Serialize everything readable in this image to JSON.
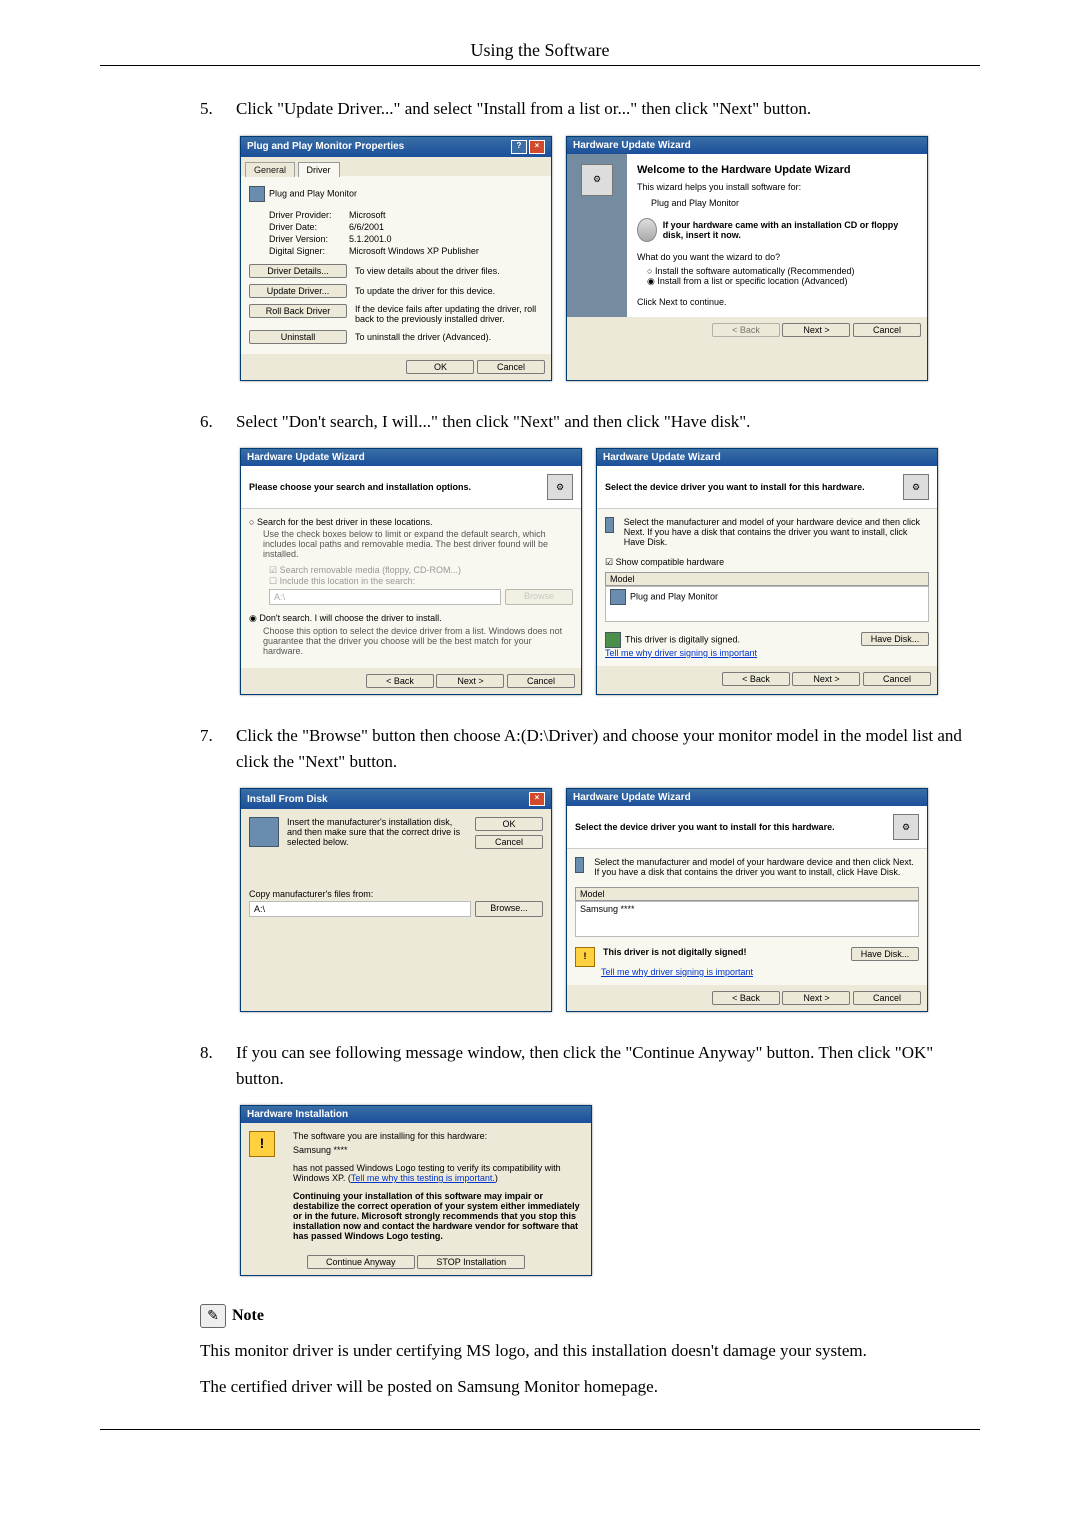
{
  "header": {
    "title": "Using the Software"
  },
  "steps": {
    "s5": {
      "num": "5.",
      "text": "Click \"Update Driver...\" and select \"Install from a list or...\" then click \"Next\" button."
    },
    "s6": {
      "num": "6.",
      "text": "Select \"Don't search, I will...\" then click \"Next\" and then click \"Have disk\"."
    },
    "s7": {
      "num": "7.",
      "text": "Click the \"Browse\" button then choose A:(D:\\Driver) and choose your monitor model in the model list and click the \"Next\" button."
    },
    "s8": {
      "num": "8.",
      "text": "If you can see following message window, then click the \"Continue Anyway\" button. Then click \"OK\" button."
    }
  },
  "win5a": {
    "title": "Plug and Play Monitor Properties",
    "tab_general": "General",
    "tab_driver": "Driver",
    "device": "Plug and Play Monitor",
    "provider_label": "Driver Provider:",
    "provider": "Microsoft",
    "date_label": "Driver Date:",
    "date": "6/6/2001",
    "version_label": "Driver Version:",
    "version": "5.1.2001.0",
    "signer_label": "Digital Signer:",
    "signer": "Microsoft Windows XP Publisher",
    "btn_details": "Driver Details...",
    "details_desc": "To view details about the driver files.",
    "btn_update": "Update Driver...",
    "update_desc": "To update the driver for this device.",
    "btn_rollback": "Roll Back Driver",
    "rollback_desc": "If the device fails after updating the driver, roll back to the previously installed driver.",
    "btn_uninstall": "Uninstall",
    "uninstall_desc": "To uninstall the driver (Advanced).",
    "ok": "OK",
    "cancel": "Cancel"
  },
  "win5b": {
    "title": "Hardware Update Wizard",
    "welcome": "Welcome to the Hardware Update Wizard",
    "intro": "This wizard helps you install software for:",
    "device": "Plug and Play Monitor",
    "cd_hint": "If your hardware came with an installation CD or floppy disk, insert it now.",
    "question": "What do you want the wizard to do?",
    "opt_auto": "Install the software automatically (Recommended)",
    "opt_list": "Install from a list or specific location (Advanced)",
    "continue": "Click Next to continue.",
    "back": "< Back",
    "next": "Next >",
    "cancel": "Cancel"
  },
  "win6a": {
    "title": "Hardware Update Wizard",
    "heading": "Please choose your search and installation options.",
    "opt_search": "Search for the best driver in these locations.",
    "search_desc": "Use the check boxes below to limit or expand the default search, which includes local paths and removable media. The best driver found will be installed.",
    "chk_media": "Search removable media (floppy, CD-ROM...)",
    "chk_include": "Include this location in the search:",
    "path": "A:\\",
    "browse": "Browse",
    "opt_dont": "Don't search. I will choose the driver to install.",
    "dont_desc": "Choose this option to select the device driver from a list. Windows does not guarantee that the driver you choose will be the best match for your hardware.",
    "back": "< Back",
    "next": "Next >",
    "cancel": "Cancel"
  },
  "win6b": {
    "title": "Hardware Update Wizard",
    "heading": "Select the device driver you want to install for this hardware.",
    "desc": "Select the manufacturer and model of your hardware device and then click Next. If you have a disk that contains the driver you want to install, click Have Disk.",
    "chk_compat": "Show compatible hardware",
    "model_label": "Model",
    "model": "Plug and Play Monitor",
    "signed": "This driver is digitally signed.",
    "why": "Tell me why driver signing is important",
    "have_disk": "Have Disk...",
    "back": "< Back",
    "next": "Next >",
    "cancel": "Cancel"
  },
  "win7a": {
    "title": "Install From Disk",
    "msg": "Insert the manufacturer's installation disk, and then make sure that the correct drive is selected below.",
    "ok": "OK",
    "cancel": "Cancel",
    "copy_label": "Copy manufacturer's files from:",
    "path": "A:\\",
    "browse": "Browse..."
  },
  "win7b": {
    "title": "Hardware Update Wizard",
    "heading": "Select the device driver you want to install for this hardware.",
    "desc": "Select the manufacturer and model of your hardware device and then click Next. If you have a disk that contains the driver you want to install, click Have Disk.",
    "model_label": "Model",
    "model": "Samsung ****",
    "warn": "This driver is not digitally signed!",
    "why": "Tell me why driver signing is important",
    "have_disk": "Have Disk...",
    "back": "< Back",
    "next": "Next >",
    "cancel": "Cancel"
  },
  "win8": {
    "title": "Hardware Installation",
    "line1": "The software you are installing for this hardware:",
    "device": "Samsung ****",
    "line2a": "has not passed Windows Logo testing to verify its compatibility with Windows XP. (",
    "line2link": "Tell me why this testing is important.",
    "line2b": ")",
    "bold": "Continuing your installation of this software may impair or destabilize the correct operation of your system either immediately or in the future. Microsoft strongly recommends that you stop this installation now and contact the hardware vendor for software that has passed Windows Logo testing.",
    "continue": "Continue Anyway",
    "stop": "STOP Installation"
  },
  "note": {
    "label": "Note",
    "p1": "This monitor driver is under certifying MS logo, and this installation doesn't damage your system.",
    "p2": "The certified driver will be posted on Samsung Monitor homepage."
  }
}
